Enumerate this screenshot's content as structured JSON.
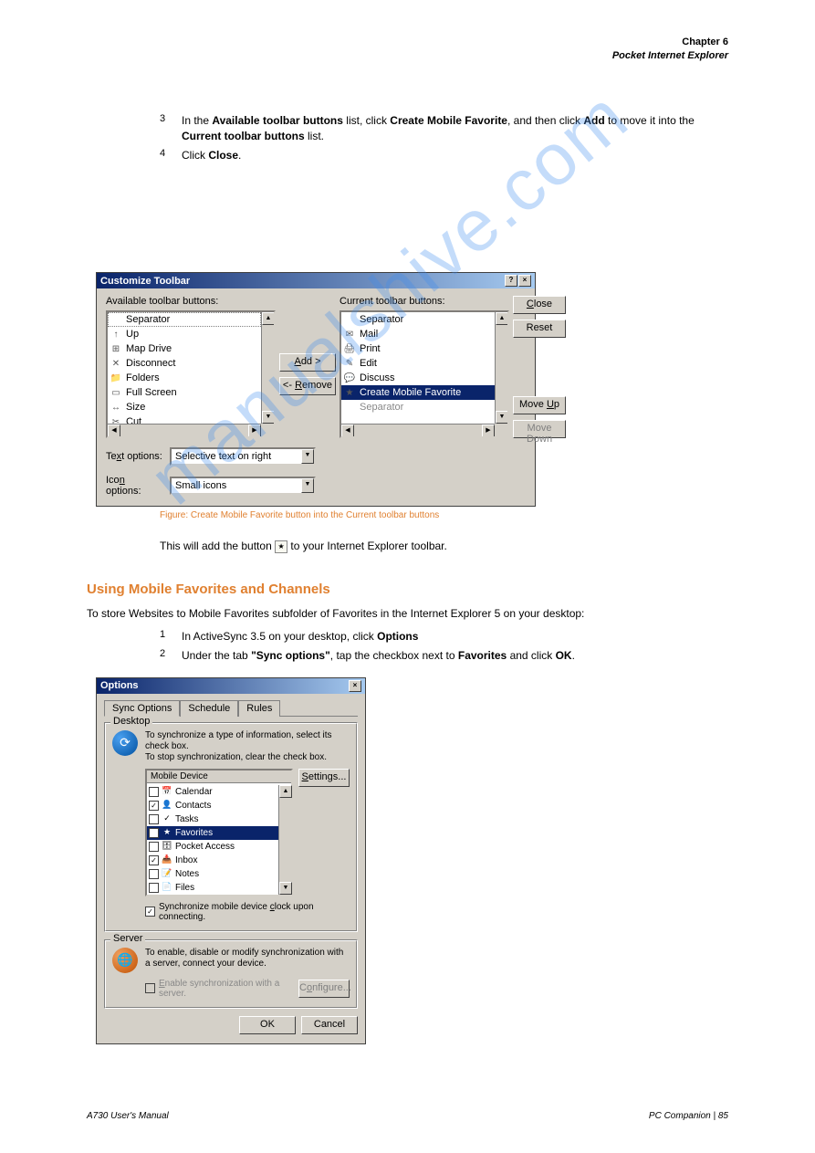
{
  "header": {
    "chapter": "Chapter 6",
    "subtitle": "Pocket Internet Explorer"
  },
  "intro_steps": [
    {
      "n": "3",
      "text": "In the <b>Available toolbar buttons</b> list, click <b>Create Mobile Favorite</b>, and then click <b>Add</b> to move it into the <b>Current toolbar buttons</b> list."
    },
    {
      "n": "4",
      "text": "Click <b>Close</b>."
    }
  ],
  "dlg1": {
    "title": "Customize Toolbar",
    "avail_label": "Available toolbar buttons:",
    "current_label": "Current toolbar buttons:",
    "avail_items": [
      {
        "icon": "",
        "label": "Separator",
        "sel": true
      },
      {
        "icon": "↑",
        "label": "Up"
      },
      {
        "icon": "⊞",
        "label": "Map Drive"
      },
      {
        "icon": "✕",
        "label": "Disconnect"
      },
      {
        "icon": "📁",
        "label": "Folders"
      },
      {
        "icon": "▭",
        "label": "Full Screen"
      },
      {
        "icon": "↔",
        "label": "Size"
      },
      {
        "icon": "✂",
        "label": "Cut"
      }
    ],
    "current_items": [
      {
        "icon": "",
        "label": "Separator"
      },
      {
        "icon": "✉",
        "label": "Mail"
      },
      {
        "icon": "🖨",
        "label": "Print"
      },
      {
        "icon": "✎",
        "label": "Edit"
      },
      {
        "icon": "💬",
        "label": "Discuss"
      },
      {
        "icon": "★",
        "label": "Create Mobile Favorite",
        "sel": true
      },
      {
        "icon": "",
        "label": "Separator",
        "dim": true
      }
    ],
    "add_btn": "Add >",
    "remove_btn": "<- Remove",
    "close_btn": "Close",
    "reset_btn": "Reset",
    "moveup_btn": "Move Up",
    "movedown_btn": "Move Down",
    "text_opt_label": "Text options:",
    "text_opt_value": "Selective text on right",
    "icon_opt_label": "Icon options:",
    "icon_opt_value": "Small icons"
  },
  "caption1": "Figure: Create Mobile Favorite button into the Current toolbar buttons",
  "followup_line": "This will add the button  to your Internet Explorer toolbar.",
  "section_heading": "Using Mobile Favorites and Channels",
  "section_intro": "To store Websites to Mobile Favorites subfolder of Favorites in the Internet Explorer 5 on your desktop:",
  "dlg2_steps": [
    {
      "n": "1",
      "text": "In ActiveSync 3.5 on your desktop, click <b>Options</b>"
    },
    {
      "n": "2",
      "text": "Under the tab <b>\"Sync options\"</b>, tap the checkbox next to <b>Favorites</b> and click <b>OK</b>."
    }
  ],
  "dlg2": {
    "title": "Options",
    "tabs": [
      "Sync Options",
      "Schedule",
      "Rules"
    ],
    "group_desktop": "Desktop",
    "sync_hint_1": "To synchronize a type of information, select its check box.",
    "sync_hint_2": "To stop synchronization, clear the check box.",
    "list_header": "Mobile Device",
    "settings_btn": "Settings...",
    "items": [
      {
        "chk": false,
        "icon": "📅",
        "label": "Calendar"
      },
      {
        "chk": true,
        "icon": "👤",
        "label": "Contacts"
      },
      {
        "chk": false,
        "icon": "✓",
        "label": "Tasks"
      },
      {
        "chk": true,
        "icon": "★",
        "label": "Favorites",
        "sel": true
      },
      {
        "chk": false,
        "icon": "🗄",
        "label": "Pocket Access"
      },
      {
        "chk": true,
        "icon": "📥",
        "label": "Inbox"
      },
      {
        "chk": false,
        "icon": "📝",
        "label": "Notes"
      },
      {
        "chk": false,
        "icon": "📄",
        "label": "Files"
      }
    ],
    "clock_chk": true,
    "clock_label": "Synchronize mobile device clock upon connecting.",
    "group_server": "Server",
    "server_hint": "To enable, disable or modify synchronization with a server, connect your device.",
    "enable_server_chk": false,
    "enable_server_label": "Enable synchronization with a server.",
    "configure_btn": "Configure...",
    "ok_btn": "OK",
    "cancel_btn": "Cancel"
  },
  "footer": {
    "left": "A730 User's Manual",
    "right": "PC Companion | 85"
  },
  "watermark": "manualshive.com"
}
